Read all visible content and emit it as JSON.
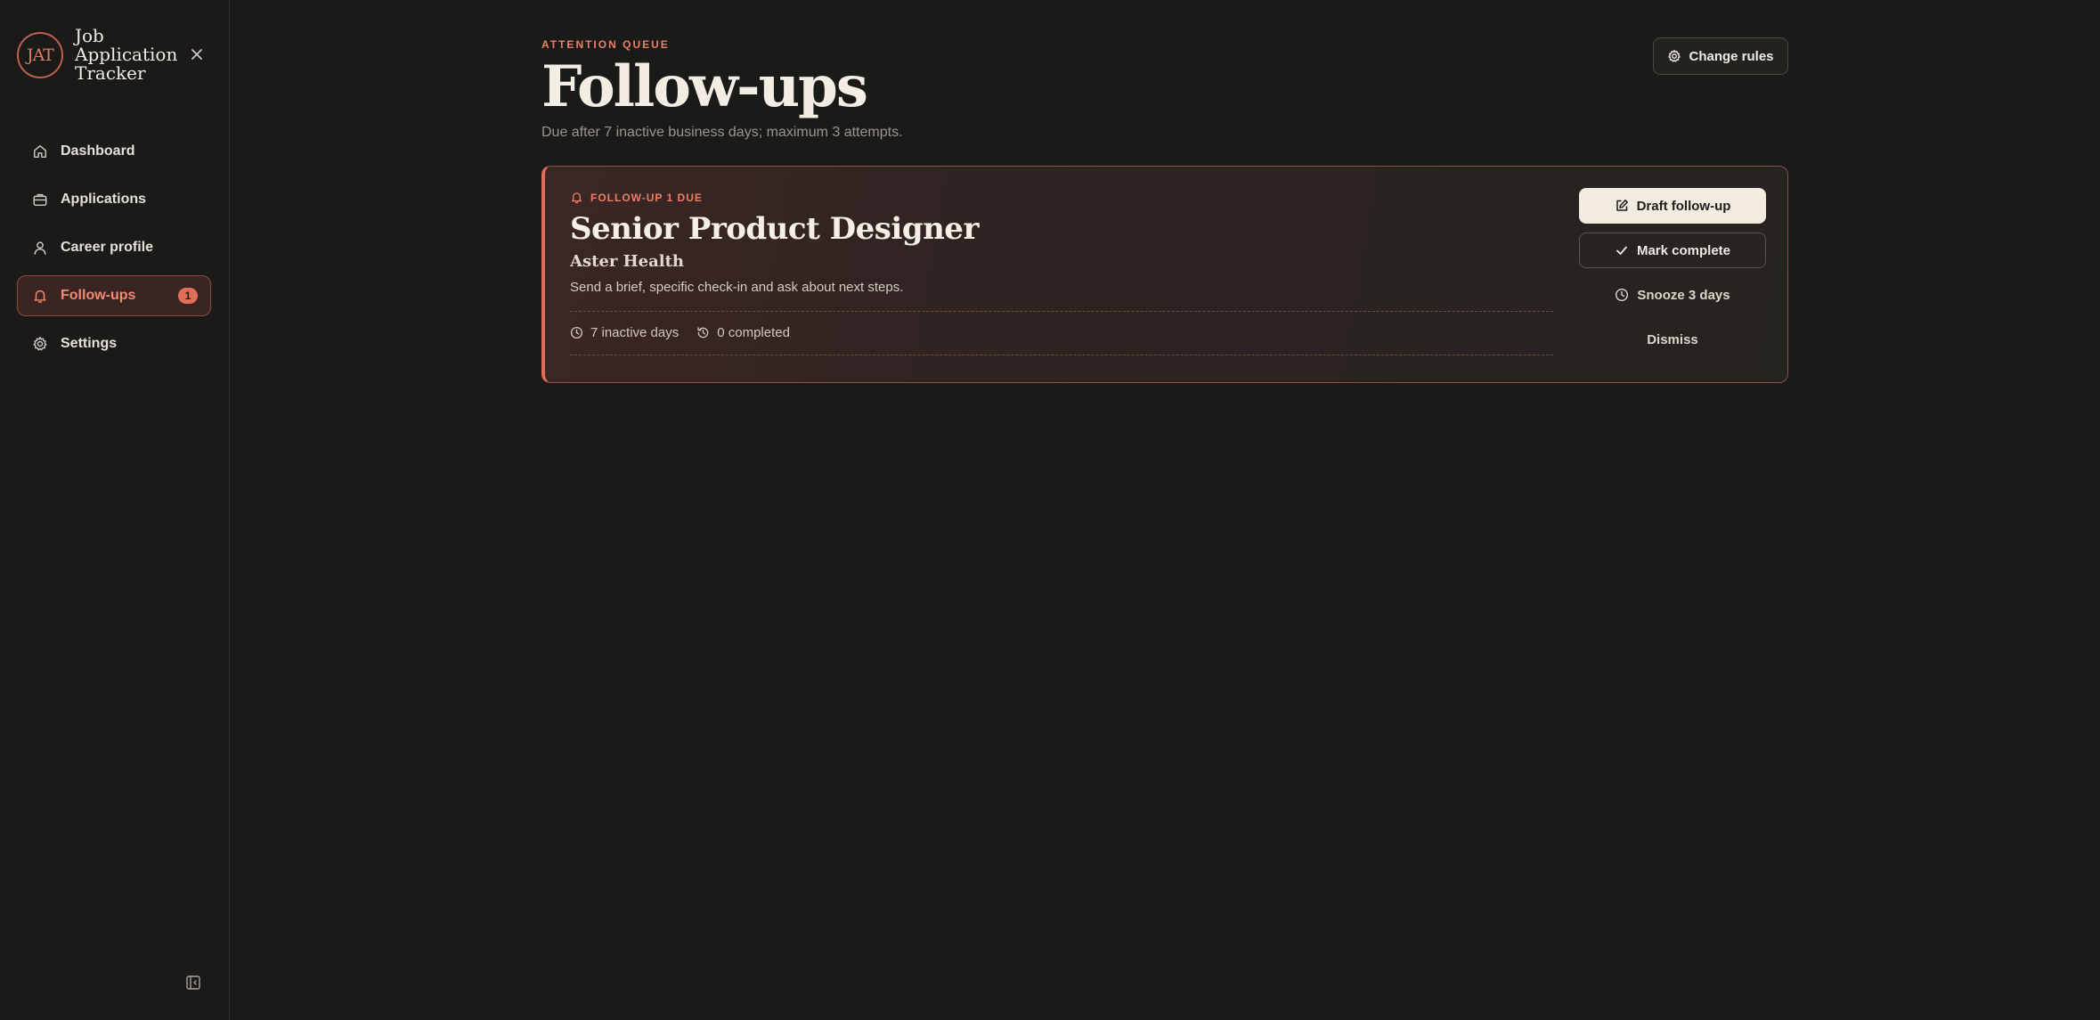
{
  "app": {
    "logo_text": "JAT",
    "name": "Job Application Tracker"
  },
  "sidebar": {
    "items": [
      {
        "label": "Dashboard",
        "icon": "home-icon"
      },
      {
        "label": "Applications",
        "icon": "briefcase-icon"
      },
      {
        "label": "Career profile",
        "icon": "user-icon"
      },
      {
        "label": "Follow-ups",
        "icon": "bell-icon",
        "active": true,
        "badge": "1"
      },
      {
        "label": "Settings",
        "icon": "gear-icon"
      }
    ]
  },
  "header": {
    "eyebrow": "ATTENTION QUEUE",
    "title": "Follow-ups",
    "subtitle": "Due after 7 inactive business days; maximum 3 attempts.",
    "change_rules_label": "Change rules"
  },
  "followup": {
    "tag": "FOLLOW-UP 1 DUE",
    "role": "Senior Product Designer",
    "company": "Aster Health",
    "hint": "Send a brief, specific check-in and ask about next steps.",
    "inactive": "7 inactive days",
    "completed": "0 completed",
    "actions": {
      "draft": "Draft follow-up",
      "complete": "Mark complete",
      "snooze": "Snooze 3 days",
      "dismiss": "Dismiss"
    }
  },
  "colors": {
    "accent": "#e06f5a",
    "background": "#1a1b19",
    "card_border": "#8e4e40",
    "primary_button": "#f2ebe0"
  }
}
